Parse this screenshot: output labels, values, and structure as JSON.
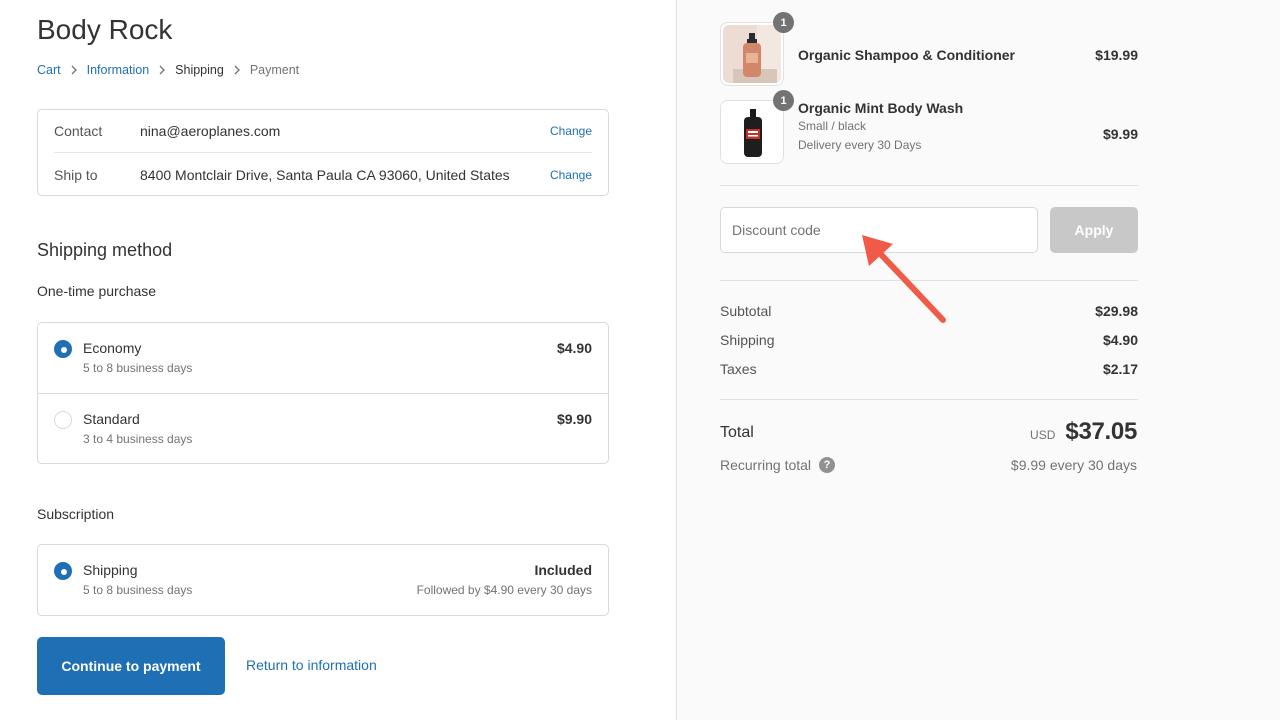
{
  "store": {
    "name": "Body Rock"
  },
  "breadcrumb": [
    {
      "label": "Cart"
    },
    {
      "label": "Information"
    },
    {
      "label": "Shipping"
    },
    {
      "label": "Payment"
    }
  ],
  "review": {
    "contact_label": "Contact",
    "contact_value": "nina@aeroplanes.com",
    "ship_label": "Ship to",
    "ship_value": "8400 Montclair Drive, Santa Paula CA 93060, United States",
    "change_label": "Change"
  },
  "shipping_method": {
    "title": "Shipping method",
    "one_time_title": "One-time purchase",
    "options": [
      {
        "name": "Economy",
        "desc": "5 to 8 business days",
        "price": "$4.90",
        "selected": true
      },
      {
        "name": "Standard",
        "desc": "3 to 4 business days",
        "price": "$9.90",
        "selected": false
      }
    ],
    "subscription_title": "Subscription",
    "subscription_option": {
      "name": "Shipping",
      "desc": "5 to 8 business days",
      "price": "Included",
      "note": "Followed by $4.90 every 30 days",
      "selected": true
    }
  },
  "actions": {
    "continue_label": "Continue to payment",
    "return_label": "Return to information"
  },
  "products": [
    {
      "name": "Organic Shampoo & Conditioner",
      "qty": "1",
      "price": "$19.99",
      "variant": "",
      "delivery": ""
    },
    {
      "name": "Organic Mint Body Wash",
      "qty": "1",
      "price": "$9.99",
      "variant": "Small / black",
      "delivery": "Delivery every 30 Days"
    }
  ],
  "discount": {
    "placeholder": "Discount code",
    "apply_label": "Apply"
  },
  "summary": {
    "subtotal_label": "Subtotal",
    "subtotal": "$29.98",
    "shipping_label": "Shipping",
    "shipping": "$4.90",
    "taxes_label": "Taxes",
    "taxes": "$2.17",
    "total_label": "Total",
    "currency": "USD",
    "total": "$37.05",
    "recurring_label": "Recurring total",
    "recurring": "$9.99 every 30 days"
  },
  "colors": {
    "accent": "#1f6fb5",
    "annotation_arrow": "#f05a47",
    "badge": "#737373"
  }
}
